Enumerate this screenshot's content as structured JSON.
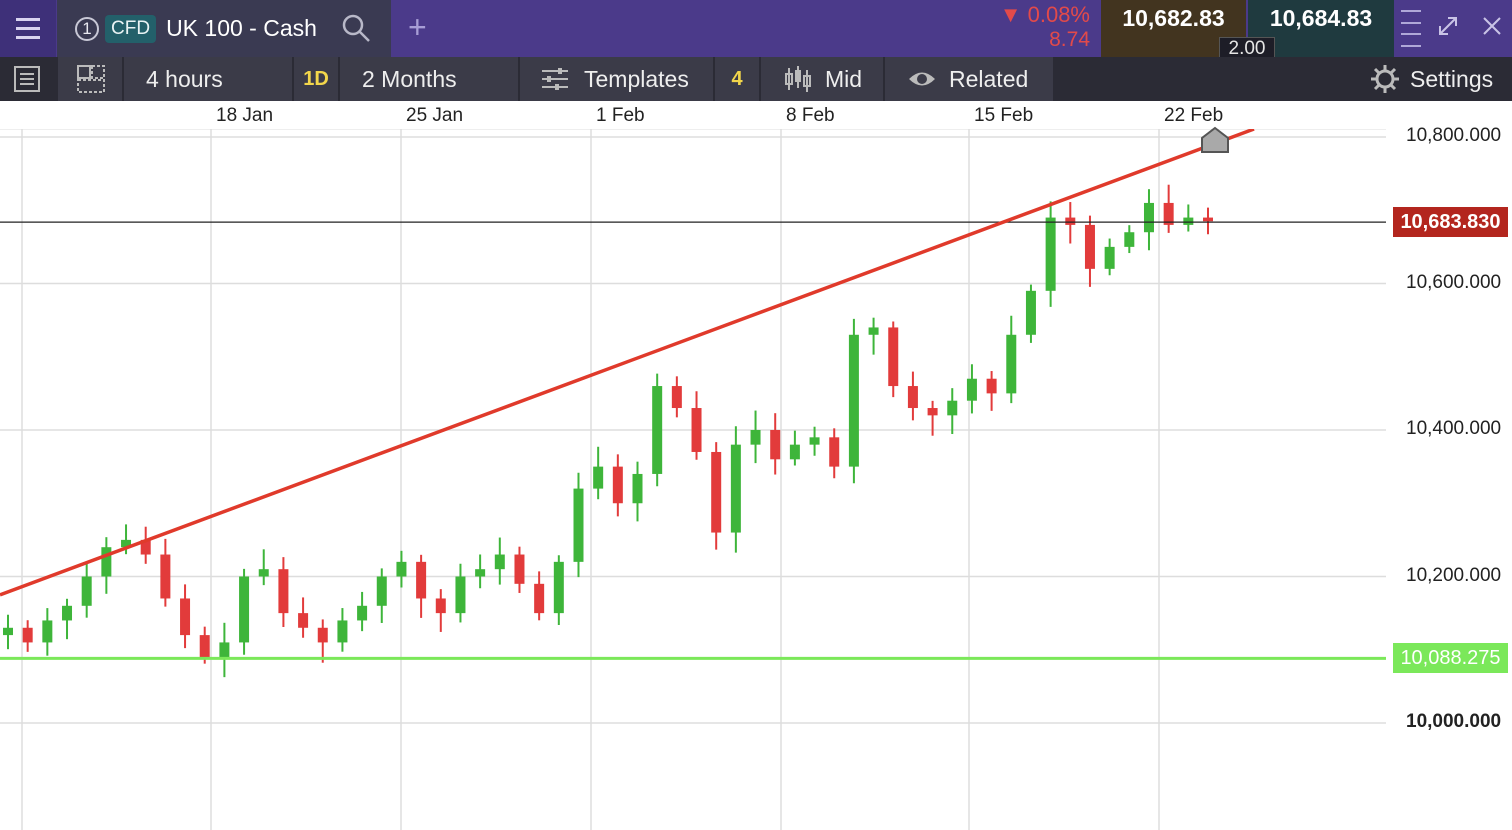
{
  "header": {
    "tab_number": "1",
    "instrument_type": "CFD",
    "instrument_name": "UK 100 - Cash",
    "add_tab_glyph": "+",
    "change_percent": "0.08%",
    "change_value": "8.74",
    "change_direction_glyph": "▼",
    "sell_price": "10,682.83",
    "buy_price": "10,684.83",
    "spread": "2.00",
    "icons": [
      "menu-icon",
      "search-icon",
      "depth-icon",
      "expand-icon",
      "close-icon"
    ]
  },
  "toolbar": {
    "interval": "4 hours",
    "interval_badge": "1D",
    "range": "2 Months",
    "templates_label": "Templates",
    "templates_count": "4",
    "price_type": "Mid",
    "related_label": "Related",
    "settings_label": "Settings"
  },
  "colors": {
    "header_bg": "#4b3a8a",
    "up_candle": "#3eb53a",
    "down_candle": "#e23b3b",
    "trendline": "#e03a2b",
    "support_line": "#7be85a",
    "current_price_tag": "#b3261e"
  },
  "chart_data": {
    "type": "candlestick",
    "instrument": "UK 100 - Cash",
    "x_ticks": [
      "18 Jan",
      "25 Jan",
      "1 Feb",
      "8 Feb",
      "15 Feb",
      "22 Feb"
    ],
    "y_ticks": [
      "10,000.000",
      "10,200.000",
      "10,400.000",
      "10,600.000",
      "10,800.000"
    ],
    "ylim": [
      9850,
      10820
    ],
    "current_price_label": "10,683.830",
    "current_price": 10683.83,
    "support_level_label": "10,088.275",
    "support_level": 10088.275,
    "trendline": {
      "from": [
        "start",
        10175
      ],
      "to": [
        "22 Feb",
        10815
      ]
    },
    "closes_approx": [
      10130,
      10110,
      10140,
      10160,
      10200,
      10240,
      10250,
      10230,
      10170,
      10120,
      10090,
      10110,
      10200,
      10210,
      10150,
      10130,
      10110,
      10140,
      10160,
      10200,
      10220,
      10170,
      10150,
      10200,
      10210,
      10230,
      10190,
      10150,
      10220,
      10320,
      10350,
      10300,
      10340,
      10460,
      10430,
      10370,
      10260,
      10380,
      10400,
      10360,
      10380,
      10390,
      10350,
      10530,
      10540,
      10460,
      10430,
      10420,
      10440,
      10470,
      10450,
      10530,
      10590,
      10690,
      10680,
      10620,
      10650,
      10670,
      10710,
      10680,
      10690,
      10685
    ]
  }
}
